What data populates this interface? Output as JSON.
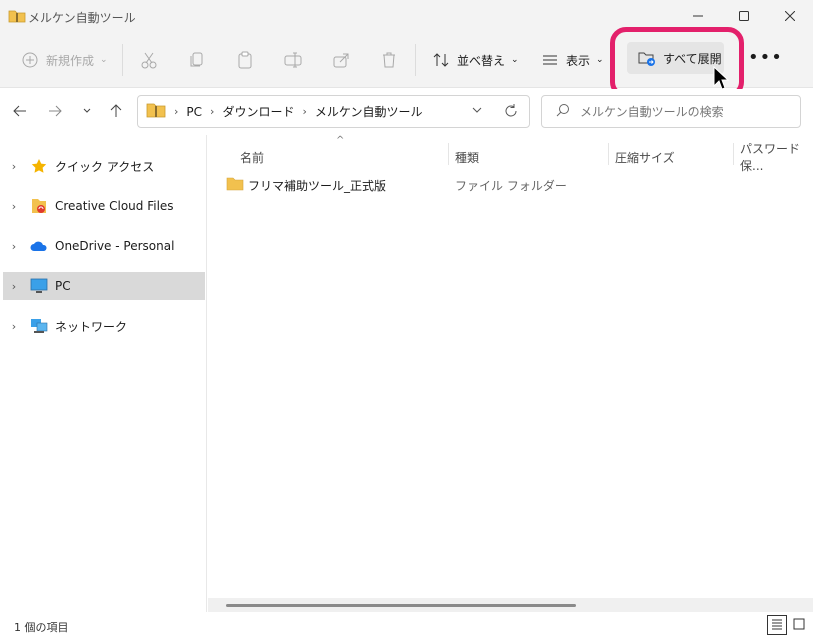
{
  "window": {
    "title": "メルケン自動ツール"
  },
  "toolbar": {
    "new_label": "新規作成",
    "sort_label": "並べ替え",
    "view_label": "表示",
    "extract_label": "すべて展開"
  },
  "address": {
    "crumbs": [
      "PC",
      "ダウンロード",
      "メルケン自動ツール"
    ]
  },
  "search": {
    "placeholder": "メルケン自動ツールの検索"
  },
  "sidebar": {
    "items": [
      {
        "label": "クイック アクセス",
        "icon": "star-icon"
      },
      {
        "label": "Creative Cloud Files",
        "icon": "creative-cloud-icon"
      },
      {
        "label": "OneDrive - Personal",
        "icon": "onedrive-cloud-icon"
      },
      {
        "label": "PC",
        "icon": "pc-monitor-icon",
        "selected": true
      },
      {
        "label": "ネットワーク",
        "icon": "network-icon"
      }
    ]
  },
  "columns": [
    "名前",
    "種類",
    "圧縮サイズ",
    "パスワード保..."
  ],
  "files": [
    {
      "name": "フリマ補助ツール_正式版",
      "type": "ファイル フォルダー"
    }
  ],
  "status": {
    "count": "1 個の項目"
  },
  "colors": {
    "highlight": "#e3206b",
    "folder": "#f2c14e",
    "selected": "#d9d9d9"
  }
}
